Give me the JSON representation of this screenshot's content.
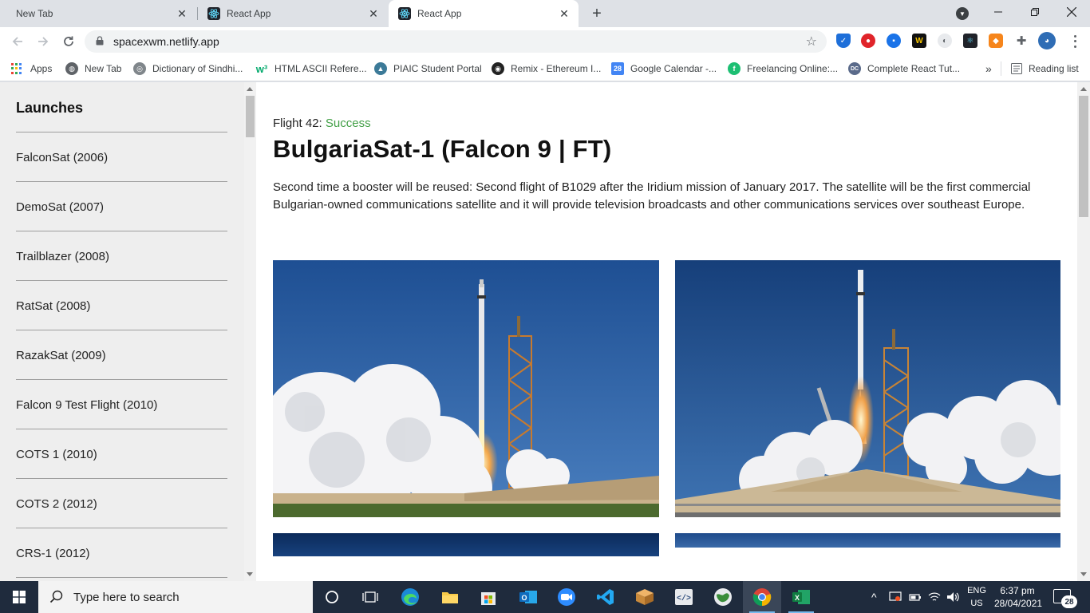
{
  "browser": {
    "tabs": [
      {
        "title": "New Tab",
        "active": false
      },
      {
        "title": "React App",
        "active": false
      },
      {
        "title": "React App",
        "active": true
      }
    ],
    "url": "spacexwm.netlify.app",
    "bookmarks": [
      {
        "label": "Apps",
        "icon": "apps-grid-icon"
      },
      {
        "label": "New Tab",
        "icon": "globe-icon"
      },
      {
        "label": "Dictionary of Sindhi...",
        "icon": "dictionary-icon"
      },
      {
        "label": "HTML ASCII Refere...",
        "icon": "w3schools-icon"
      },
      {
        "label": "PIAIC Student Portal",
        "icon": "piaic-icon"
      },
      {
        "label": "Remix - Ethereum I...",
        "icon": "remix-icon"
      },
      {
        "label": "Google Calendar -...",
        "icon": "calendar-icon",
        "icon_text": "28"
      },
      {
        "label": "Freelancing Online:...",
        "icon": "freelancing-icon"
      },
      {
        "label": "Complete React Tut...",
        "icon": "codevolution-icon",
        "icon_text": "DC"
      }
    ],
    "bookmarks_overflow": "»",
    "reading_list": "Reading list",
    "icon_colors": {
      "globe": "#5f6368",
      "dictionary": "#80868b",
      "w3schools": "#04aa6d",
      "piaic": "#3c7a98",
      "remix": "#222222",
      "calendar": "#4285f4",
      "freelancing": "#1dbf73",
      "codevolution": "#5a6a8a"
    }
  },
  "sidebar": {
    "heading": "Launches",
    "items": [
      "FalconSat (2006)",
      "DemoSat (2007)",
      "Trailblazer (2008)",
      "RatSat (2008)",
      "RazakSat (2009)",
      "Falcon 9 Test Flight (2010)",
      "COTS 1 (2010)",
      "COTS 2 (2012)",
      "CRS-1 (2012)"
    ]
  },
  "launch": {
    "flight_label": "Flight 42:",
    "status": "Success",
    "status_color": "#43a047",
    "title": "BulgariaSat-1 (Falcon 9 | FT)",
    "description": "Second time a booster will be reused: Second flight of B1029 after the Iridium mission of January 2017. The satellite will be the first commercial Bulgarian-owned communications satellite and it will provide television broadcasts and other communications services over southeast Europe."
  },
  "taskbar": {
    "search_placeholder": "Type here to search",
    "apps": [
      "task-view",
      "edge",
      "file-explorer",
      "store",
      "outlook",
      "zoom",
      "vscode",
      "package-app",
      "dev-app",
      "world-app",
      "chrome",
      "excel"
    ],
    "lang_top": "ENG",
    "lang_bottom": "US",
    "time": "6:37 pm",
    "date": "28/04/2021",
    "notification_count": "28",
    "tray_chevron": "^"
  }
}
